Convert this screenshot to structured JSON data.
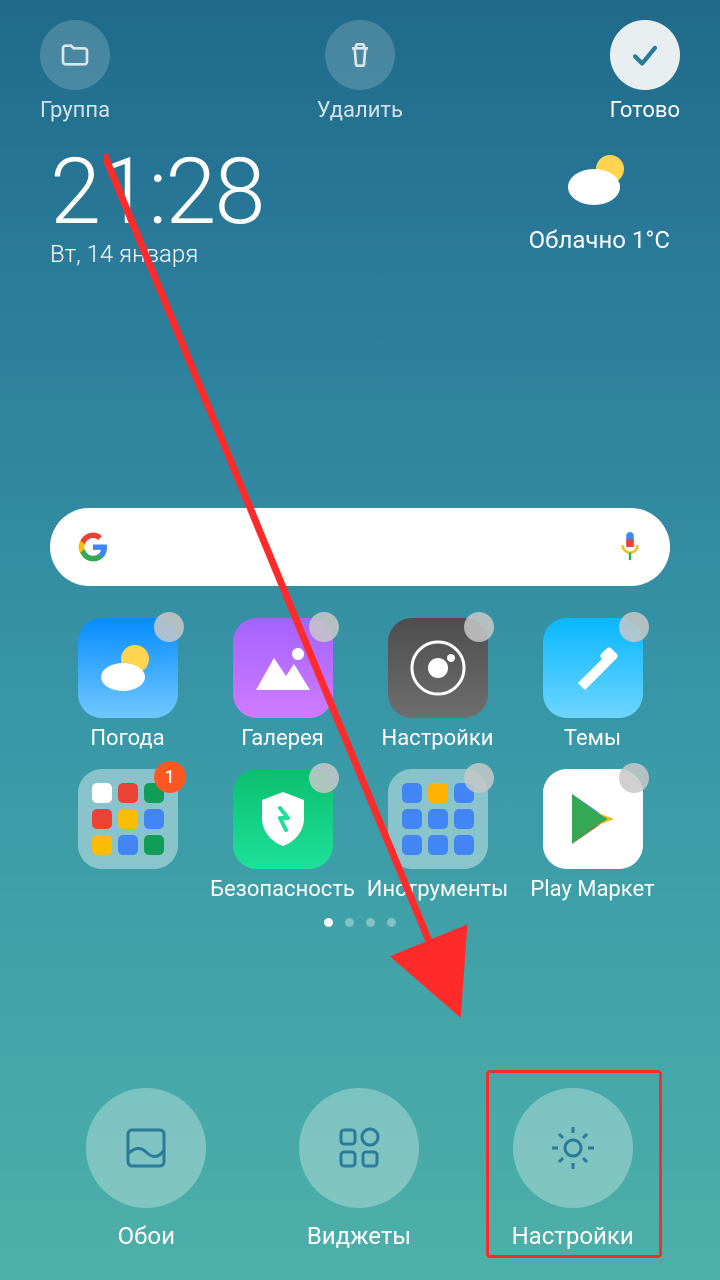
{
  "top": {
    "group": "Группа",
    "delete": "Удалить",
    "done": "Готово"
  },
  "clock": {
    "time": "21:28",
    "date": "Вт, 14 января"
  },
  "weather": {
    "desc": "Облачно  1°C"
  },
  "apps": {
    "weather": "Погода",
    "gallery": "Галерея",
    "settings": "Настройки",
    "themes": "Темы",
    "security": "Безопасность",
    "tools": "Инструменты",
    "play": "Play Маркет",
    "folder_badge": "1"
  },
  "bottom": {
    "wallpaper": "Обои",
    "widgets": "Виджеты",
    "settings": "Настройки"
  }
}
